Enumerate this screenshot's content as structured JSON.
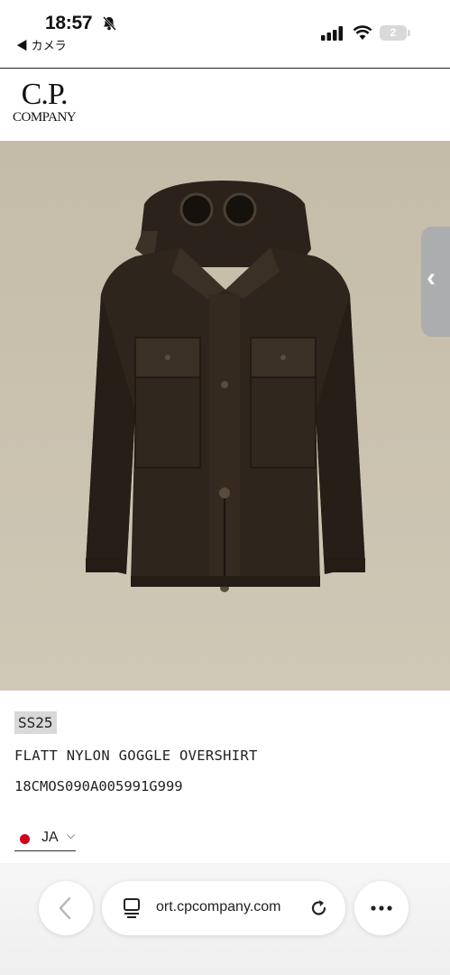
{
  "status_bar": {
    "time": "18:57",
    "back_app": "◀ カメラ",
    "battery": "2"
  },
  "header": {
    "logo_top": "C.P.",
    "logo_bottom": "COMPANY"
  },
  "product": {
    "season": "SS25",
    "name": "FLATT NYLON GOGGLE OVERSHIRT",
    "sku": "18CMOS090A005991G999",
    "image_background": "#c9c1ae",
    "jacket_color": "#2e251c"
  },
  "side_tab": {
    "glyph": "‹"
  },
  "language": {
    "label": "JA",
    "chevron": "⌵",
    "dot_color": "#d0021b"
  },
  "browser": {
    "url": "ort.cpcompany.com",
    "back_glyph": "‹",
    "more_glyph": "•••",
    "icons": [
      "chevron-left-icon",
      "tabs-icon",
      "reload-icon",
      "more-icon"
    ]
  }
}
